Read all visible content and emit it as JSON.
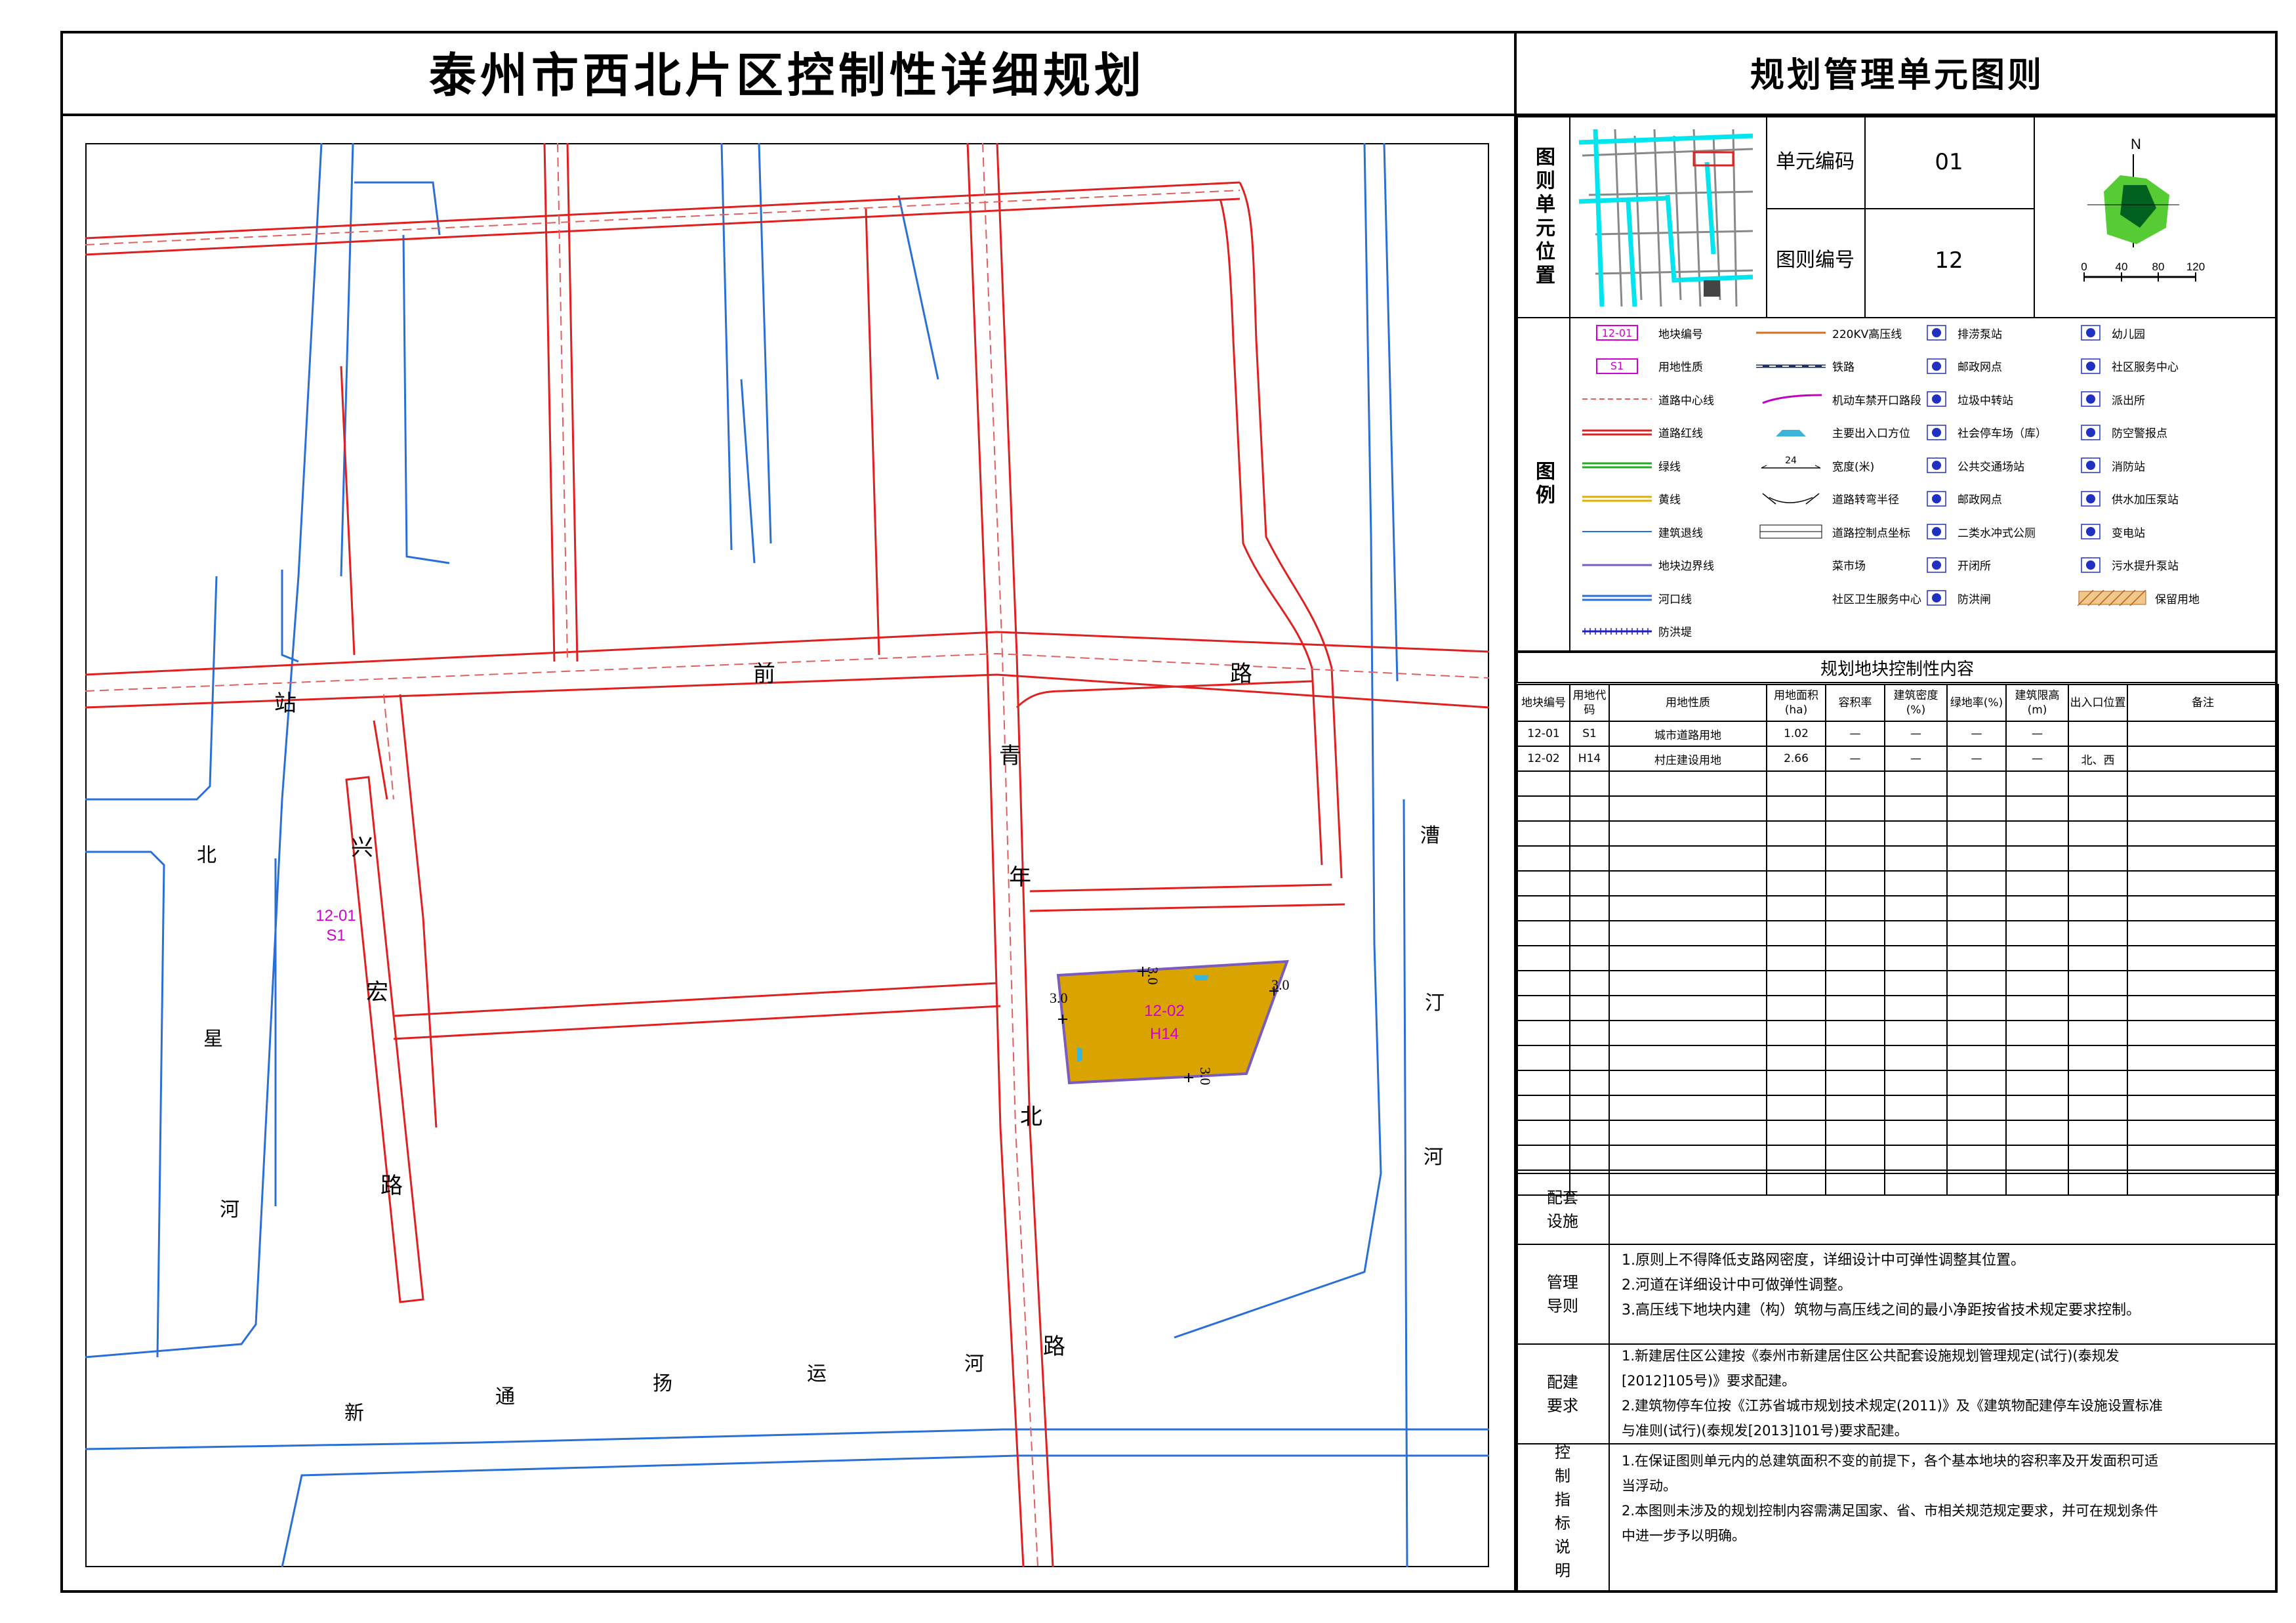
{
  "title": "泰州市西北片区控制性详细规划",
  "subtitle": "规划管理单元图则",
  "map": {
    "roads": [
      {
        "name": "站前路",
        "chars": [
          "站",
          "前",
          "路"
        ]
      },
      {
        "name": "青年北路",
        "chars": [
          "青",
          "年",
          "北",
          "路"
        ]
      },
      {
        "name": "兴宏路",
        "chars": [
          "兴",
          "宏",
          "路"
        ]
      }
    ],
    "rivers": [
      {
        "name": "北星河",
        "chars": [
          "北",
          "星",
          "河"
        ]
      },
      {
        "name": "溱汀河",
        "chars": [
          "漕",
          "汀",
          "河"
        ]
      },
      {
        "name": "新通扬运河",
        "chars": [
          "新",
          "通",
          "扬",
          "运",
          "河"
        ]
      }
    ],
    "parcels": [
      {
        "code": "12-01",
        "use": "S1"
      },
      {
        "code": "12-02",
        "use": "H14"
      }
    ],
    "setbacks": [
      "3.0",
      "3.0",
      "3.0",
      "3.0"
    ]
  },
  "unit_info": {
    "location_label": "图则单元位置",
    "unit_code_label": "单元编码",
    "unit_code": "01",
    "sheet_no_label": "图则编号",
    "sheet_no": "12",
    "north": "N",
    "scale": [
      "0",
      "40",
      "80",
      "120"
    ]
  },
  "legend": {
    "label": "图例",
    "items": [
      {
        "label": "地块编号",
        "sample": "12-01",
        "icon": "parcel-code-box"
      },
      {
        "label": "用地性质",
        "sample": "S1",
        "icon": "land-use-box"
      },
      {
        "label": "道路中心线",
        "icon": "dashed-red-line"
      },
      {
        "label": "道路红线",
        "icon": "red-double-line"
      },
      {
        "label": "绿线",
        "icon": "green-double-line"
      },
      {
        "label": "黄线",
        "icon": "yellow-double-line"
      },
      {
        "label": "建筑退线",
        "icon": "blue-thin-line"
      },
      {
        "label": "地块边界线",
        "icon": "purple-line"
      },
      {
        "label": "河口线",
        "icon": "blue-double-line"
      },
      {
        "label": "防洪堤",
        "icon": "levee-hatch-line"
      },
      {
        "label": "220KV高压线",
        "icon": "orange-line"
      },
      {
        "label": "铁路",
        "icon": "railway-line"
      },
      {
        "label": "机动车禁开口路段",
        "icon": "magenta-curve"
      },
      {
        "label": "主要出入口方位",
        "icon": "entrance-arrow"
      },
      {
        "label": "宽度(米)",
        "sample": "24",
        "icon": "width-dimension"
      },
      {
        "label": "道路转弯半径",
        "icon": "turning-radius"
      },
      {
        "label": "道路控制点坐标",
        "icon": "control-point-coords"
      },
      {
        "label": "菜市场",
        "icon": "market-icon"
      },
      {
        "label": "社区卫生服务中心",
        "icon": "clinic-icon"
      },
      {
        "label": "排涝泵站",
        "icon": "drainage-pump-icon"
      },
      {
        "label": "邮政网点",
        "icon": "post-icon"
      },
      {
        "label": "垃圾中转站",
        "icon": "garbage-icon"
      },
      {
        "label": "社会停车场（库）",
        "icon": "parking-icon"
      },
      {
        "label": "公共交通场站",
        "icon": "bus-station-icon"
      },
      {
        "label": "邮政网点",
        "icon": "post-office-icon"
      },
      {
        "label": "二类水冲式公厕",
        "icon": "toilet-icon"
      },
      {
        "label": "开闭所",
        "icon": "switch-station-icon"
      },
      {
        "label": "防洪闸",
        "icon": "flood-gate-icon"
      },
      {
        "label": "幼儿园",
        "icon": "kindergarten-icon"
      },
      {
        "label": "社区服务中心",
        "icon": "community-center-icon"
      },
      {
        "label": "派出所",
        "icon": "police-icon"
      },
      {
        "label": "防空警报点",
        "icon": "air-raid-icon"
      },
      {
        "label": "消防站",
        "icon": "fire-station-icon"
      },
      {
        "label": "供水加压泵站",
        "icon": "water-pump-icon"
      },
      {
        "label": "变电站",
        "icon": "substation-icon"
      },
      {
        "label": "污水提升泵站",
        "icon": "sewage-pump-icon"
      },
      {
        "label": "保留用地",
        "icon": "reserved-land-hatch"
      }
    ]
  },
  "control_table": {
    "title": "规划地块控制性内容",
    "headers": [
      "地块编号",
      "用地代码",
      "用地性质",
      "用地面积(ha)",
      "容积率",
      "建筑密度(%)",
      "绿地率(%)",
      "建筑限高(m)",
      "出入口位置",
      "备注"
    ],
    "rows": [
      [
        "12-01",
        "S1",
        "城市道路用地",
        "1.02",
        "—",
        "—",
        "—",
        "—",
        "",
        ""
      ],
      [
        "12-02",
        "H14",
        "村庄建设用地",
        "2.66",
        "—",
        "—",
        "—",
        "—",
        "北、西",
        ""
      ]
    ],
    "empty_rows": 17
  },
  "sections": {
    "facilities": {
      "label": "配套设施",
      "text": ""
    },
    "management": {
      "label": "管理导则",
      "lines": [
        "1.原则上不得降低支路网密度，详细设计中可弹性调整其位置。",
        "2.河道在详细设计中可做弹性调整。",
        "3.高压线下地块内建（构）筑物与高压线之间的最小净距按省技术规定要求控制。"
      ]
    },
    "requirements": {
      "label": "配建要求",
      "lines": [
        "1.新建居住区公建按《泰州市新建居住区公共配套设施规划管理规定(试行)(泰规发",
        "[2012]105号)》要求配建。",
        "2.建筑物停车位按《江苏省城市规划技术规定(2011)》及《建筑物配建停车设施设置标准",
        "与准则(试行)(泰规发[2013]101号)要求配建。"
      ]
    },
    "control_notes": {
      "label": "控制指标说明",
      "lines": [
        "1.在保证图则单元内的总建筑面积不变的前提下，各个基本地块的容积率及开发面积可适",
        "当浮动。",
        "2.本图则未涉及的规划控制内容需满足国家、省、市相关规范规定要求，并可在规划条件",
        "中进一步予以明确。"
      ]
    }
  },
  "colors": {
    "road_red": "#e02020",
    "river_blue": "#2a6fd6",
    "parcel_fill": "#d9a300",
    "parcel_edge": "#7a5cc0",
    "label_magenta": "#d000d0",
    "cyan": "#00e5ee"
  }
}
